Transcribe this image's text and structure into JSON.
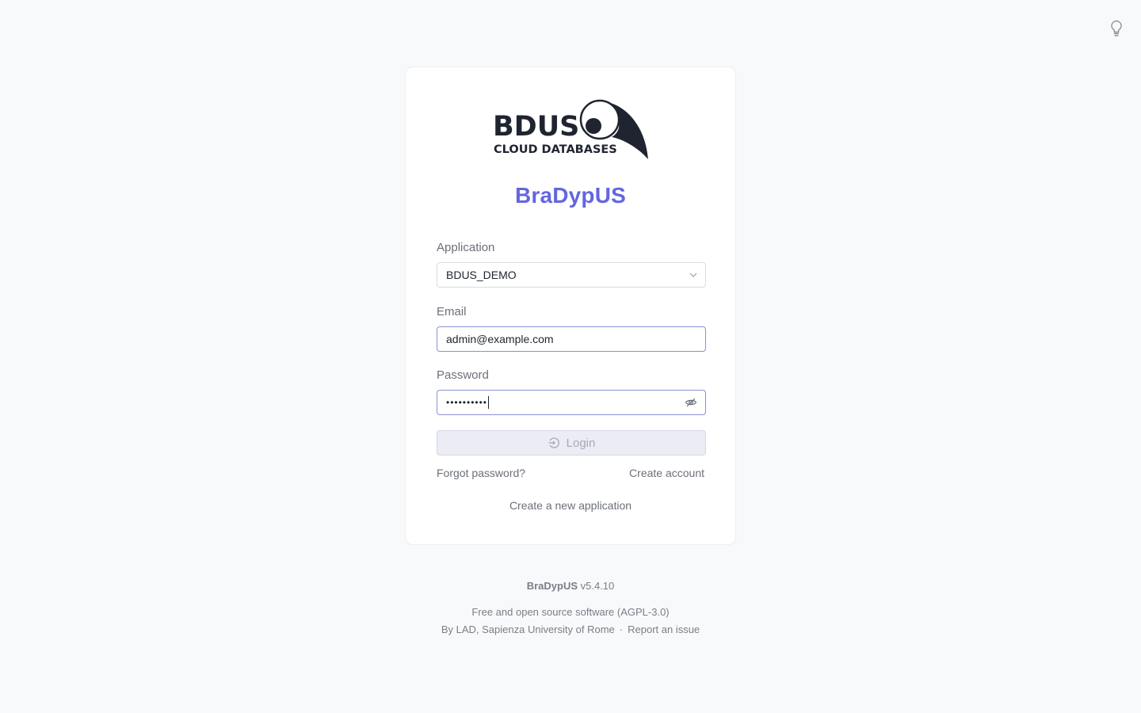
{
  "brand": {
    "logo_main": "BDUS",
    "logo_sub": "CLOUD DATABASES",
    "app_name": "BraDypUS"
  },
  "form": {
    "application_label": "Application",
    "application_value": "BDUS_DEMO",
    "email_label": "Email",
    "email_value": "admin@example.com",
    "password_label": "Password",
    "password_mask": "••••••••••",
    "login_label": "Login",
    "forgot_password": "Forgot password?",
    "create_account": "Create account",
    "create_application": "Create a new application"
  },
  "footer": {
    "product": "BraDypUS",
    "version": "v5.4.10",
    "license": "Free and open source software (AGPL-3.0)",
    "credits": "By LAD, Sapienza University of Rome",
    "separator": "·",
    "report_issue": "Report an issue"
  },
  "icons": {
    "theme": "lightbulb-icon",
    "select": "chevron-down-icon",
    "password_toggle": "eye-off-icon",
    "login": "login-icon"
  },
  "colors": {
    "accent": "#6366e0",
    "background": "#f8f9fb",
    "card": "#ffffff",
    "button_disabled": "#ebecf4"
  }
}
